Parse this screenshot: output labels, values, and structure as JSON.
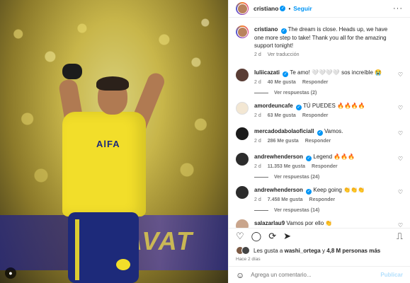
{
  "post": {
    "username": "cristiano",
    "follow_label": "Seguir",
    "more_label": "···",
    "caption": "The dream is close. Heads up, we have one more step to take! Thank you all for the amazing support tonight!",
    "caption_age": "2 d",
    "translate_label": "Ver traducción",
    "photo_sponsor": "AlFA",
    "photo_banner": "AVAT"
  },
  "comments": [
    {
      "user": "luliicazati",
      "verified": true,
      "text": "Te amo! 🤍🤍🤍🤍 sos increíble 😭",
      "age": "2 d",
      "likes": "40 Me gusta",
      "reply": "Responder",
      "replies": "Ver respuestas (2)",
      "avatar_color": "#5a3d35"
    },
    {
      "user": "amordeuncafe",
      "verified": true,
      "text": "TÚ PUEDES 🔥🔥🔥🔥",
      "age": "2 d",
      "likes": "63 Me gusta",
      "reply": "Responder",
      "replies": "",
      "avatar_color": "#f3e7d3"
    },
    {
      "user": "mercadodabolaoficiall",
      "verified": true,
      "text": "Vamos.",
      "age": "2 d",
      "likes": "286 Me gusta",
      "reply": "Responder",
      "replies": "",
      "avatar_color": "#1b1b1b"
    },
    {
      "user": "andrewhenderson",
      "verified": true,
      "text": "Legend 🔥🔥🔥",
      "age": "2 d",
      "likes": "11.353 Me gusta",
      "reply": "Responder",
      "replies": "Ver respuestas (24)",
      "avatar_color": "#2c2c2c"
    },
    {
      "user": "andrewhenderson",
      "verified": true,
      "text": "Keep going 👏👏👏",
      "age": "2 d",
      "likes": "7.458 Me gusta",
      "reply": "Responder",
      "replies": "Ver respuestas (14)",
      "avatar_color": "#2c2c2c"
    },
    {
      "user": "salazarlau9",
      "verified": false,
      "text": "Vamos por ello 👏",
      "age": "",
      "likes": "",
      "reply": "",
      "replies": "",
      "avatar_color": "#c9a58c"
    }
  ],
  "actions": {
    "like_icon": "heart-icon",
    "comment_icon": "comment-icon",
    "share_icon": "repost-icon",
    "send_icon": "send-icon",
    "save_icon": "bookmark-icon"
  },
  "likes": {
    "prefix": "Les gusta a ",
    "user": "washi_ortega",
    "middle": " y ",
    "count": "4,8 M personas más"
  },
  "time_ago": "Hace 2 días",
  "add_comment": {
    "placeholder": "Agrega un comentario...",
    "post_label": "Publicar"
  },
  "colors": {
    "accent": "#0095f6",
    "shirt": "#f2de2a",
    "shorts": "#1d2a7a"
  }
}
